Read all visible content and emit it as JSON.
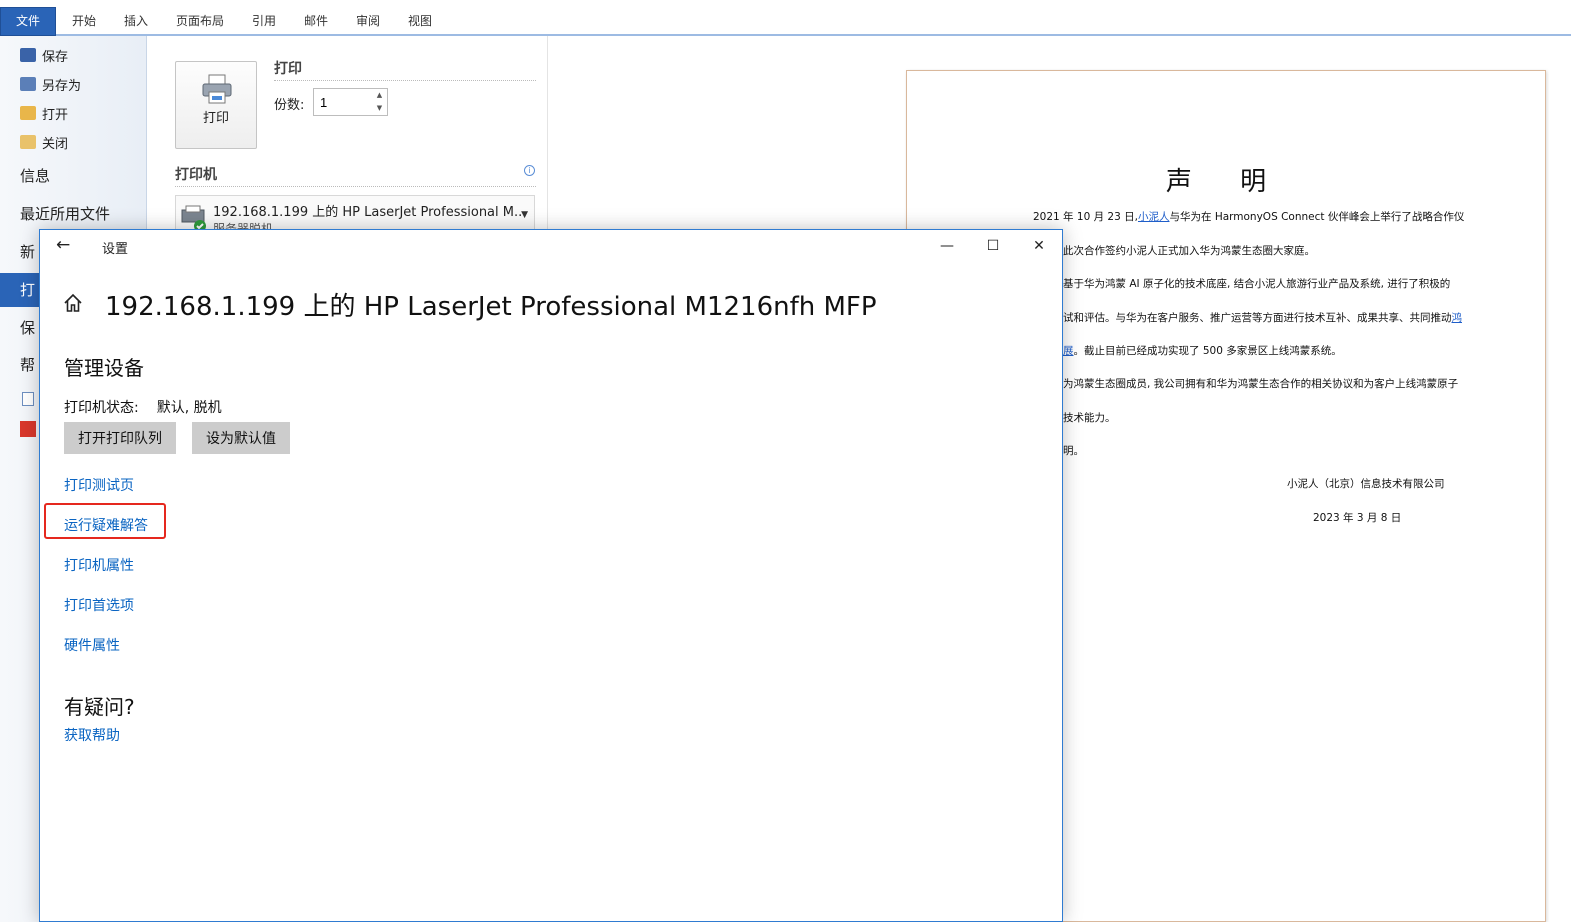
{
  "ribbon": {
    "tabs": [
      "文件",
      "开始",
      "插入",
      "页面布局",
      "引用",
      "邮件",
      "审阅",
      "视图"
    ]
  },
  "backstage": {
    "items": [
      "保存",
      "另存为",
      "打开",
      "关闭"
    ],
    "big_items": [
      "信息",
      "最近所用文件",
      "新建",
      "打印",
      "保存并发送",
      "帮助"
    ],
    "big_items_visible": [
      "信息",
      "最近所用文件",
      "新",
      "打",
      "保",
      "帮"
    ]
  },
  "print_pane": {
    "button_label": "打印",
    "title": "打印",
    "copies_label": "份数:",
    "copies_value": "1",
    "printer_heading": "打印机",
    "printer_name": "192.168.1.199 上的 HP LaserJet Professional M...",
    "printer_status": "服务器脱机"
  },
  "document": {
    "title": "声 明",
    "lines": [
      {
        "pre": "2021 年 10 月 23 日,",
        "link": "小泥人",
        "post": "与华为在 HarmonyOS Connect 伙伴峰会上举行了战略合作仪"
      },
      {
        "pre": "此次合作签约小泥人正式加入华为鸿蒙生态圈大家庭。",
        "link": "",
        "post": ""
      },
      {
        "pre": "基于华为鸿蒙 AI 原子化的技术底座, 结合小泥人旅游行业产品及系统, 进行了积极的",
        "link": "",
        "post": ""
      },
      {
        "pre": "试和评估。与华为在客户服务、推广运营等方面进行技术互补、成果共享、共同推动",
        "link": "鸿",
        "post": ""
      },
      {
        "pre": "",
        "link": "展",
        "post": "。截止目前已经成功实现了 500 多家景区上线鸿蒙系统。"
      },
      {
        "pre": "为鸿蒙生态圈成员, 我公司拥有和华为鸿蒙生态合作的相关协议和为客户上线鸿蒙原子",
        "link": "",
        "post": ""
      },
      {
        "pre": "技术能力。",
        "link": "",
        "post": ""
      },
      {
        "pre": "明。",
        "link": "",
        "post": ""
      }
    ],
    "signature": "小泥人（北京）信息技术有限公司",
    "date": "2023 年 3 月 8 日"
  },
  "settings": {
    "window_title": "设置",
    "minimize": "—",
    "maximize": "☐",
    "close": "✕",
    "page_heading": "192.168.1.199 上的 HP LaserJet Professional M1216nfh MFP",
    "section_title": "管理设备",
    "status_label": "打印机状态:",
    "status_value": "默认, 脱机",
    "btn_open_queue": "打开打印队列",
    "btn_set_default": "设为默认值",
    "links": [
      "打印测试页",
      "运行疑难解答",
      "打印机属性",
      "打印首选项",
      "硬件属性"
    ],
    "question_title": "有疑问?",
    "help_link": "获取帮助"
  },
  "colors": {
    "accent": "#2a64b7",
    "link": "#0a64c2",
    "highlight": "#e5281e"
  }
}
